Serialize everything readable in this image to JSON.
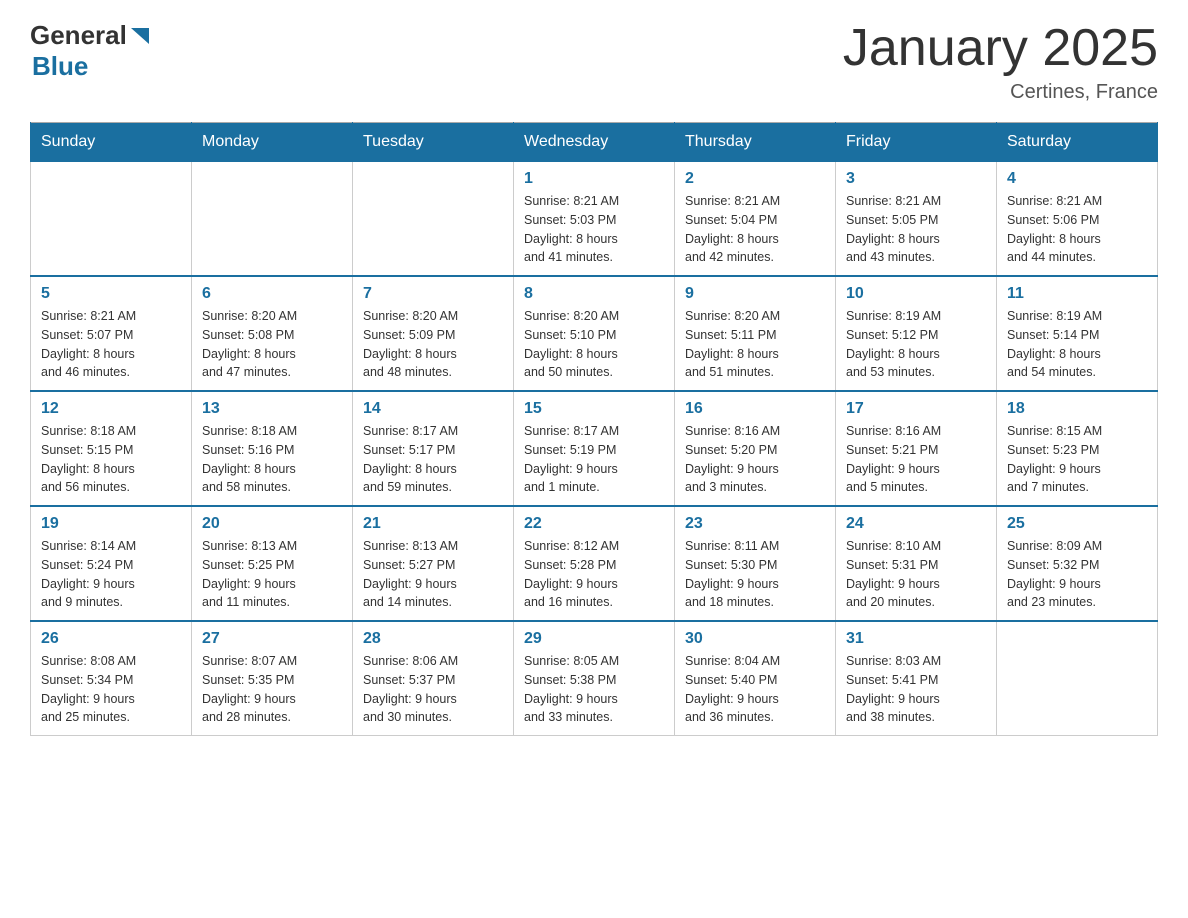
{
  "header": {
    "title": "January 2025",
    "subtitle": "Certines, France",
    "logo_general": "General",
    "logo_blue": "Blue"
  },
  "days_of_week": [
    "Sunday",
    "Monday",
    "Tuesday",
    "Wednesday",
    "Thursday",
    "Friday",
    "Saturday"
  ],
  "weeks": [
    [
      {
        "day": "",
        "info": ""
      },
      {
        "day": "",
        "info": ""
      },
      {
        "day": "",
        "info": ""
      },
      {
        "day": "1",
        "info": "Sunrise: 8:21 AM\nSunset: 5:03 PM\nDaylight: 8 hours\nand 41 minutes."
      },
      {
        "day": "2",
        "info": "Sunrise: 8:21 AM\nSunset: 5:04 PM\nDaylight: 8 hours\nand 42 minutes."
      },
      {
        "day": "3",
        "info": "Sunrise: 8:21 AM\nSunset: 5:05 PM\nDaylight: 8 hours\nand 43 minutes."
      },
      {
        "day": "4",
        "info": "Sunrise: 8:21 AM\nSunset: 5:06 PM\nDaylight: 8 hours\nand 44 minutes."
      }
    ],
    [
      {
        "day": "5",
        "info": "Sunrise: 8:21 AM\nSunset: 5:07 PM\nDaylight: 8 hours\nand 46 minutes."
      },
      {
        "day": "6",
        "info": "Sunrise: 8:20 AM\nSunset: 5:08 PM\nDaylight: 8 hours\nand 47 minutes."
      },
      {
        "day": "7",
        "info": "Sunrise: 8:20 AM\nSunset: 5:09 PM\nDaylight: 8 hours\nand 48 minutes."
      },
      {
        "day": "8",
        "info": "Sunrise: 8:20 AM\nSunset: 5:10 PM\nDaylight: 8 hours\nand 50 minutes."
      },
      {
        "day": "9",
        "info": "Sunrise: 8:20 AM\nSunset: 5:11 PM\nDaylight: 8 hours\nand 51 minutes."
      },
      {
        "day": "10",
        "info": "Sunrise: 8:19 AM\nSunset: 5:12 PM\nDaylight: 8 hours\nand 53 minutes."
      },
      {
        "day": "11",
        "info": "Sunrise: 8:19 AM\nSunset: 5:14 PM\nDaylight: 8 hours\nand 54 minutes."
      }
    ],
    [
      {
        "day": "12",
        "info": "Sunrise: 8:18 AM\nSunset: 5:15 PM\nDaylight: 8 hours\nand 56 minutes."
      },
      {
        "day": "13",
        "info": "Sunrise: 8:18 AM\nSunset: 5:16 PM\nDaylight: 8 hours\nand 58 minutes."
      },
      {
        "day": "14",
        "info": "Sunrise: 8:17 AM\nSunset: 5:17 PM\nDaylight: 8 hours\nand 59 minutes."
      },
      {
        "day": "15",
        "info": "Sunrise: 8:17 AM\nSunset: 5:19 PM\nDaylight: 9 hours\nand 1 minute."
      },
      {
        "day": "16",
        "info": "Sunrise: 8:16 AM\nSunset: 5:20 PM\nDaylight: 9 hours\nand 3 minutes."
      },
      {
        "day": "17",
        "info": "Sunrise: 8:16 AM\nSunset: 5:21 PM\nDaylight: 9 hours\nand 5 minutes."
      },
      {
        "day": "18",
        "info": "Sunrise: 8:15 AM\nSunset: 5:23 PM\nDaylight: 9 hours\nand 7 minutes."
      }
    ],
    [
      {
        "day": "19",
        "info": "Sunrise: 8:14 AM\nSunset: 5:24 PM\nDaylight: 9 hours\nand 9 minutes."
      },
      {
        "day": "20",
        "info": "Sunrise: 8:13 AM\nSunset: 5:25 PM\nDaylight: 9 hours\nand 11 minutes."
      },
      {
        "day": "21",
        "info": "Sunrise: 8:13 AM\nSunset: 5:27 PM\nDaylight: 9 hours\nand 14 minutes."
      },
      {
        "day": "22",
        "info": "Sunrise: 8:12 AM\nSunset: 5:28 PM\nDaylight: 9 hours\nand 16 minutes."
      },
      {
        "day": "23",
        "info": "Sunrise: 8:11 AM\nSunset: 5:30 PM\nDaylight: 9 hours\nand 18 minutes."
      },
      {
        "day": "24",
        "info": "Sunrise: 8:10 AM\nSunset: 5:31 PM\nDaylight: 9 hours\nand 20 minutes."
      },
      {
        "day": "25",
        "info": "Sunrise: 8:09 AM\nSunset: 5:32 PM\nDaylight: 9 hours\nand 23 minutes."
      }
    ],
    [
      {
        "day": "26",
        "info": "Sunrise: 8:08 AM\nSunset: 5:34 PM\nDaylight: 9 hours\nand 25 minutes."
      },
      {
        "day": "27",
        "info": "Sunrise: 8:07 AM\nSunset: 5:35 PM\nDaylight: 9 hours\nand 28 minutes."
      },
      {
        "day": "28",
        "info": "Sunrise: 8:06 AM\nSunset: 5:37 PM\nDaylight: 9 hours\nand 30 minutes."
      },
      {
        "day": "29",
        "info": "Sunrise: 8:05 AM\nSunset: 5:38 PM\nDaylight: 9 hours\nand 33 minutes."
      },
      {
        "day": "30",
        "info": "Sunrise: 8:04 AM\nSunset: 5:40 PM\nDaylight: 9 hours\nand 36 minutes."
      },
      {
        "day": "31",
        "info": "Sunrise: 8:03 AM\nSunset: 5:41 PM\nDaylight: 9 hours\nand 38 minutes."
      },
      {
        "day": "",
        "info": ""
      }
    ]
  ]
}
